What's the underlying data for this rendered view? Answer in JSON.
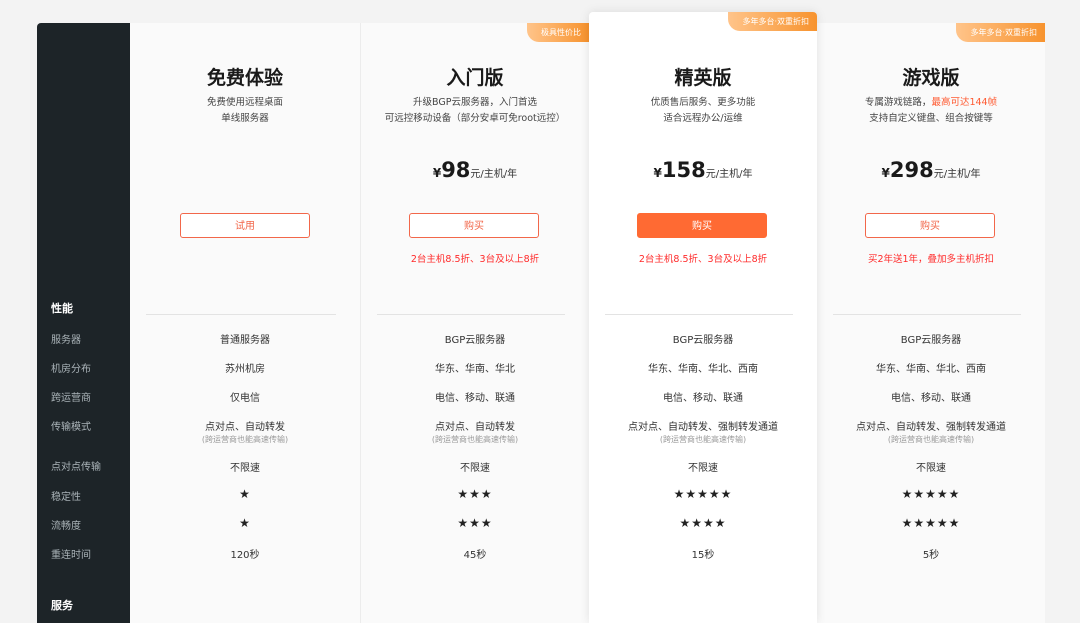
{
  "sidebar": {
    "section_performance": "性能",
    "rows": [
      "服务器",
      "机房分布",
      "跨运营商",
      "传输模式",
      "点对点传输",
      "稳定性",
      "流畅度",
      "重连时间"
    ],
    "section_service": "服务"
  },
  "plans": [
    {
      "name": "免费体验",
      "ribbon": "",
      "desc1": "免费使用远程桌面",
      "desc2": "单线服务器",
      "desc_hot": "",
      "desc1_tail": "",
      "price_currency": "",
      "price": "",
      "price_unit": "",
      "button": "试用",
      "button_style": "outline",
      "promo": "",
      "server": "普通服务器",
      "location": "苏州机房",
      "cross_isp": "仅电信",
      "mode": "点对点、自动转发",
      "mode_note": "(跨运营商也能高速传输)",
      "p2p": "不限速",
      "stability": "★",
      "smoothness": "★",
      "reconnect": "120秒"
    },
    {
      "name": "入门版",
      "ribbon": "极具性价比",
      "desc1": "升级BGP云服务器，入门首选",
      "desc2": "可远控移动设备（部分安卓可免root远控）",
      "desc_hot": "",
      "desc1_tail": "",
      "price_currency": "¥",
      "price": "98",
      "price_unit": "元/主机/年",
      "button": "购买",
      "button_style": "outline",
      "promo": "2台主机8.5折、3台及以上8折",
      "server": "BGP云服务器",
      "location": "华东、华南、华北",
      "cross_isp": "电信、移动、联通",
      "mode": "点对点、自动转发",
      "mode_note": "(跨运营商也能高速传输)",
      "p2p": "不限速",
      "stability": "★★★",
      "smoothness": "★★★",
      "reconnect": "45秒"
    },
    {
      "name": "精英版",
      "ribbon": "多年多台·双重折扣",
      "desc1": "优质售后服务、更多功能",
      "desc2": "适合远程办公/运维",
      "desc_hot": "",
      "desc1_tail": "",
      "price_currency": "¥",
      "price": "158",
      "price_unit": "元/主机/年",
      "button": "购买",
      "button_style": "solid",
      "promo": "2台主机8.5折、3台及以上8折",
      "server": "BGP云服务器",
      "location": "华东、华南、华北、西南",
      "cross_isp": "电信、移动、联通",
      "mode": "点对点、自动转发、强制转发通道",
      "mode_note": "(跨运营商也能高速传输)",
      "p2p": "不限速",
      "stability": "★★★★★",
      "smoothness": "★★★★",
      "reconnect": "15秒"
    },
    {
      "name": "游戏版",
      "ribbon": "多年多台·双重折扣",
      "desc1": "专属游戏链路，",
      "desc_hot": "最高可达144帧",
      "desc1_tail": "",
      "desc2": "支持自定义键盘、组合按键等",
      "price_currency": "¥",
      "price": "298",
      "price_unit": "元/主机/年",
      "button": "购买",
      "button_style": "outline",
      "promo": "买2年送1年，叠加多主机折扣",
      "server": "BGP云服务器",
      "location": "华东、华南、华北、西南",
      "cross_isp": "电信、移动、联通",
      "mode": "点对点、自动转发、强制转发通道",
      "mode_note": "(跨运营商也能高速传输)",
      "p2p": "不限速",
      "stability": "★★★★★",
      "smoothness": "★★★★★",
      "reconnect": "5秒"
    }
  ]
}
